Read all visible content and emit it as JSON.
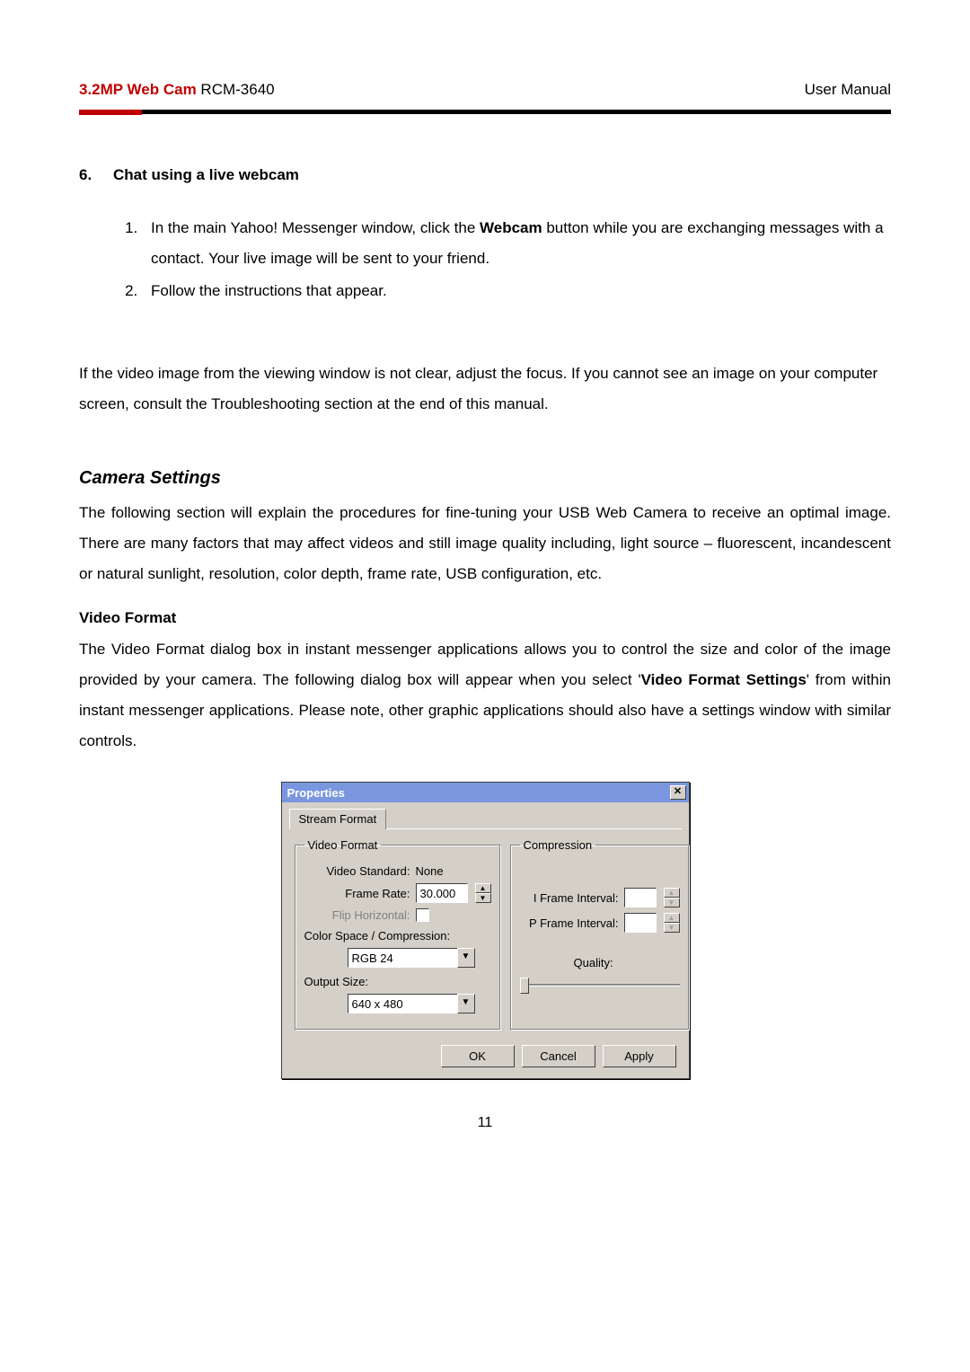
{
  "header": {
    "product_red": "3.2MP Web Cam",
    "product_model": " RCM-3640",
    "right": "User Manual"
  },
  "section6": {
    "number": "6.",
    "title": "Chat using a live webcam",
    "step1_a": "In the main Yahoo! Messenger window, click the ",
    "step1_bold": "Webcam",
    "step1_b": " button while you are exchanging messages with a contact. Your live image will be sent to your friend.",
    "step2": "Follow the instructions that appear."
  },
  "focus_para": "If the video image from the viewing window is not clear, adjust the focus. If you cannot see an image on your computer screen, consult the Troubleshooting section at the end of this manual.",
  "camera_settings": {
    "title": "Camera Settings",
    "intro": "The following section will explain the procedures for fine-tuning your USB Web Camera to receive an optimal image. There are many factors that may affect videos and still image quality including, light source – fluorescent, incandescent or natural sunlight, resolution, color depth, frame rate, USB configuration, etc.",
    "sub_title": "Video Format",
    "sub_a": "The Video Format dialog box in instant messenger applications allows you to control the size and color of the image provided by your camera. The following dialog box will appear when you select '",
    "sub_bold": "Video Format Settings",
    "sub_b": "' from within instant messenger applications. Please note, other graphic applications should also have a settings window with similar controls."
  },
  "dialog": {
    "title": "Properties",
    "close_glyph": "✕",
    "tab": "Stream Format",
    "group_vf": "Video Format",
    "group_cp": "Compression",
    "labels": {
      "video_standard": "Video Standard:",
      "frame_rate": "Frame Rate:",
      "flip_horizontal": "Flip Horizontal:",
      "color_space": "Color Space / Compression:",
      "output_size": "Output Size:",
      "i_frame": "I Frame Interval:",
      "p_frame": "P Frame Interval:",
      "quality": "Quality:"
    },
    "values": {
      "video_standard": "None",
      "frame_rate": "30.000",
      "color_space": "RGB 24",
      "output_size": "640 x 480",
      "i_frame": "",
      "p_frame": ""
    },
    "buttons": {
      "ok": "OK",
      "cancel": "Cancel",
      "apply": "Apply"
    },
    "glyphs": {
      "up": "▲",
      "down": "▼"
    }
  },
  "page_number": "11"
}
